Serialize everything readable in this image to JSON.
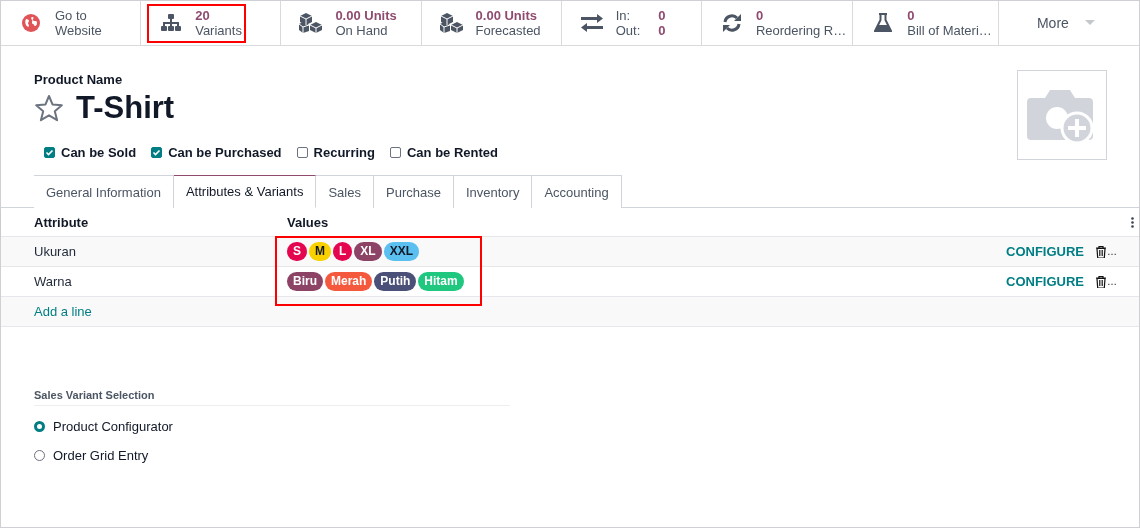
{
  "stat_buttons": [
    {
      "kind": "website",
      "value": "Go to",
      "label": "Website",
      "highlighted": false
    },
    {
      "kind": "variants",
      "value": "20",
      "label": "Variants",
      "highlighted": true
    },
    {
      "kind": "on_hand",
      "value": "0.00 Units",
      "label": "On Hand",
      "highlighted": false
    },
    {
      "kind": "forecasted",
      "value": "0.00 Units",
      "label": "Forecasted",
      "highlighted": false
    },
    {
      "kind": "moves",
      "in_label": "In:",
      "in_value": "0",
      "out_label": "Out:",
      "out_value": "0",
      "highlighted": false
    },
    {
      "kind": "reordering",
      "value": "0",
      "label": "Reordering R…",
      "highlighted": false
    },
    {
      "kind": "bom",
      "value": "0",
      "label": "Bill of Materi…",
      "highlighted": false
    },
    {
      "kind": "more",
      "label": "More",
      "highlighted": false
    }
  ],
  "product": {
    "name_label": "Product Name",
    "name": "T-Shirt",
    "favorite": false,
    "options": [
      {
        "label": "Can be Sold",
        "checked": true
      },
      {
        "label": "Can be Purchased",
        "checked": true
      },
      {
        "label": "Recurring",
        "checked": false
      },
      {
        "label": "Can be Rented",
        "checked": false
      }
    ]
  },
  "tabs": [
    {
      "label": "General Information",
      "selected": false
    },
    {
      "label": "Attributes & Variants",
      "selected": true
    },
    {
      "label": "Sales",
      "selected": false
    },
    {
      "label": "Purchase",
      "selected": false
    },
    {
      "label": "Inventory",
      "selected": false
    },
    {
      "label": "Accounting",
      "selected": false
    }
  ],
  "attributes": {
    "columns": [
      "Attribute",
      "Values"
    ],
    "values_highlighted": true,
    "rows": [
      {
        "attribute": "Ukuran",
        "values": [
          {
            "label": "S",
            "color": "#e4064f"
          },
          {
            "label": "M",
            "color": "#f9d000"
          },
          {
            "label": "L",
            "color": "#e4064f"
          },
          {
            "label": "XL",
            "color": "#8c4366"
          },
          {
            "label": "XXL",
            "color": "#5bc0f0"
          }
        ],
        "action": "CONFIGURE",
        "delete_text": "…"
      },
      {
        "attribute": "Warna",
        "values": [
          {
            "label": "Biru",
            "color": "#8c4366"
          },
          {
            "label": "Merah",
            "color": "#f5593d"
          },
          {
            "label": "Putih",
            "color": "#4b5078"
          },
          {
            "label": "Hitam",
            "color": "#20c77f"
          }
        ],
        "action": "CONFIGURE",
        "delete_text": "…"
      }
    ],
    "add_line": "Add a line"
  },
  "sales_variant_selection": {
    "title": "Sales Variant Selection",
    "options": [
      {
        "label": "Product Configurator",
        "selected": true
      },
      {
        "label": "Order Grid Entry",
        "selected": false
      }
    ]
  }
}
